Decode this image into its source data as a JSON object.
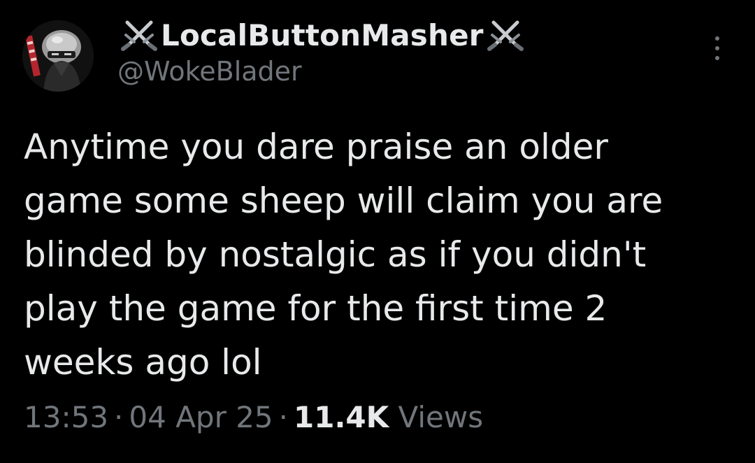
{
  "author": {
    "display_name": "LocalButtonMasher",
    "handle": "@WokeBlader",
    "name_decoration_icon": "crossed-swords-icon"
  },
  "tweet": {
    "text_lines": [
      "Anytime you dare praise an older",
      "game some sheep will claim you are",
      "blinded by nostalgic as if you didn't",
      "play the game for the first time 2",
      "weeks ago lol"
    ],
    "time": "13:53",
    "separator": "·",
    "date": "04 Apr 25",
    "views_count": "11.4K",
    "views_label": "Views"
  },
  "menu_icon": "more-options-icon",
  "colors": {
    "background": "#000000",
    "primary_text": "#e7e9ea",
    "secondary_text": "#71767b"
  }
}
